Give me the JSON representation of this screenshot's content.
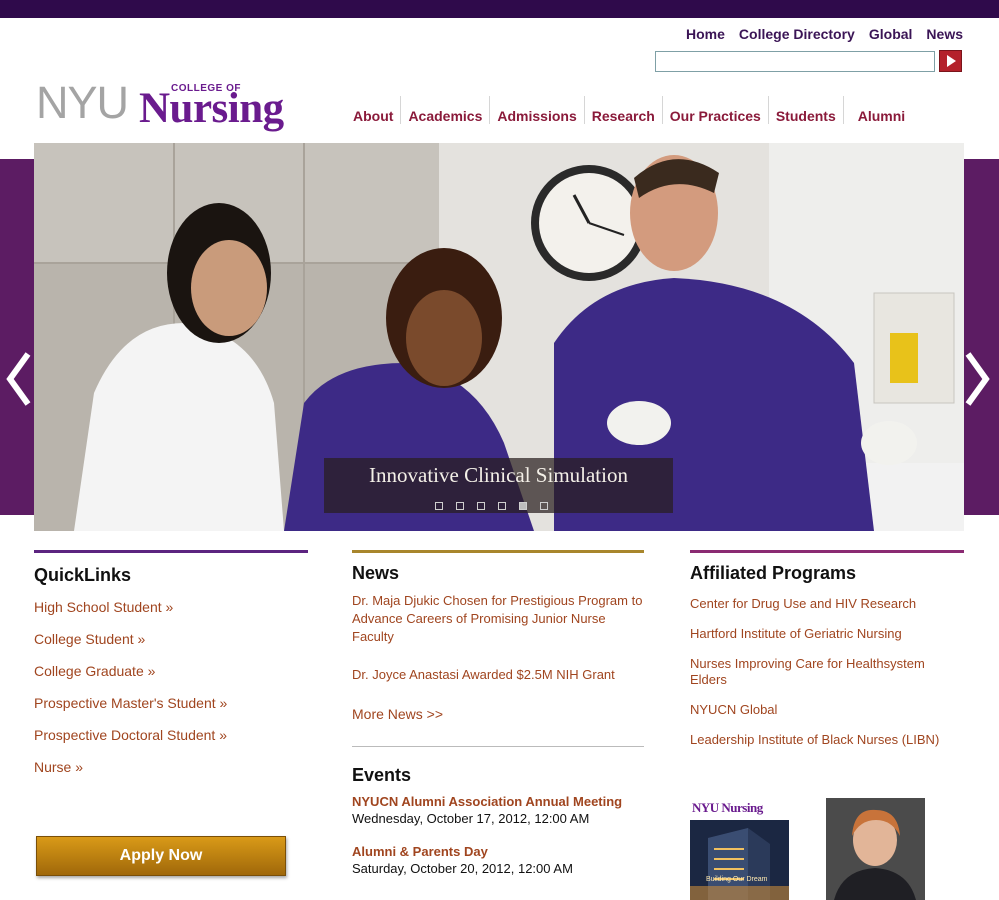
{
  "utility_nav": [
    "Home",
    "College Directory",
    "Global",
    "News"
  ],
  "search": {
    "placeholder": "",
    "button_icon": "play-arrow-icon"
  },
  "logo": {
    "nyu": "NYU",
    "college": "COLLEGE OF",
    "nursing": "Nursing"
  },
  "main_nav": [
    "About",
    "Academics",
    "Admissions",
    "Research",
    "Our Practices",
    "Students",
    "Alumni"
  ],
  "hero": {
    "caption": "Innovative Clinical Simulation",
    "slide_count": 6,
    "active_slide": 5,
    "prev_icon": "chevron-left-icon",
    "next_icon": "chevron-right-icon"
  },
  "quicklinks": {
    "title": "QuickLinks",
    "items": [
      "High School Student »",
      "College Student »",
      "College Graduate »",
      "Prospective Master's Student »",
      "Prospective Doctoral Student »",
      "Nurse »"
    ],
    "apply_label": "Apply Now"
  },
  "news": {
    "title": "News",
    "items": [
      "Dr. Maja Djukic Chosen for Prestigious Program to Advance Careers of Promising Junior Nurse Faculty",
      "Dr. Joyce Anastasi Awarded $2.5M NIH Grant"
    ],
    "more": "More News >>"
  },
  "events": {
    "title": "Events",
    "items": [
      {
        "title": "NYUCN Alumni Association Annual Meeting",
        "date": "Wednesday, October 17, 2012, 12:00 AM"
      },
      {
        "title": "Alumni & Parents Day",
        "date": "Saturday, October 20, 2012, 12:00 AM"
      }
    ]
  },
  "affiliated": {
    "title": "Affiliated Programs",
    "items": [
      "Center for Drug Use and HIV Research",
      "Hartford Institute of Geriatric Nursing",
      "Nurses Improving Care for Healthsystem Elders",
      "NYUCN Global",
      "Leadership Institute of Black Nurses (LIBN)"
    ],
    "magazine": {
      "logo": "NYU Nursing",
      "tagline": "Building Our Dream"
    }
  },
  "colors": {
    "topbar": "#2f0a4b",
    "band": "#5c1c63",
    "nav_link": "#8a1a3a",
    "link": "#a0451f",
    "logo_purple": "#6a1b8e",
    "apply": "#c98610"
  }
}
